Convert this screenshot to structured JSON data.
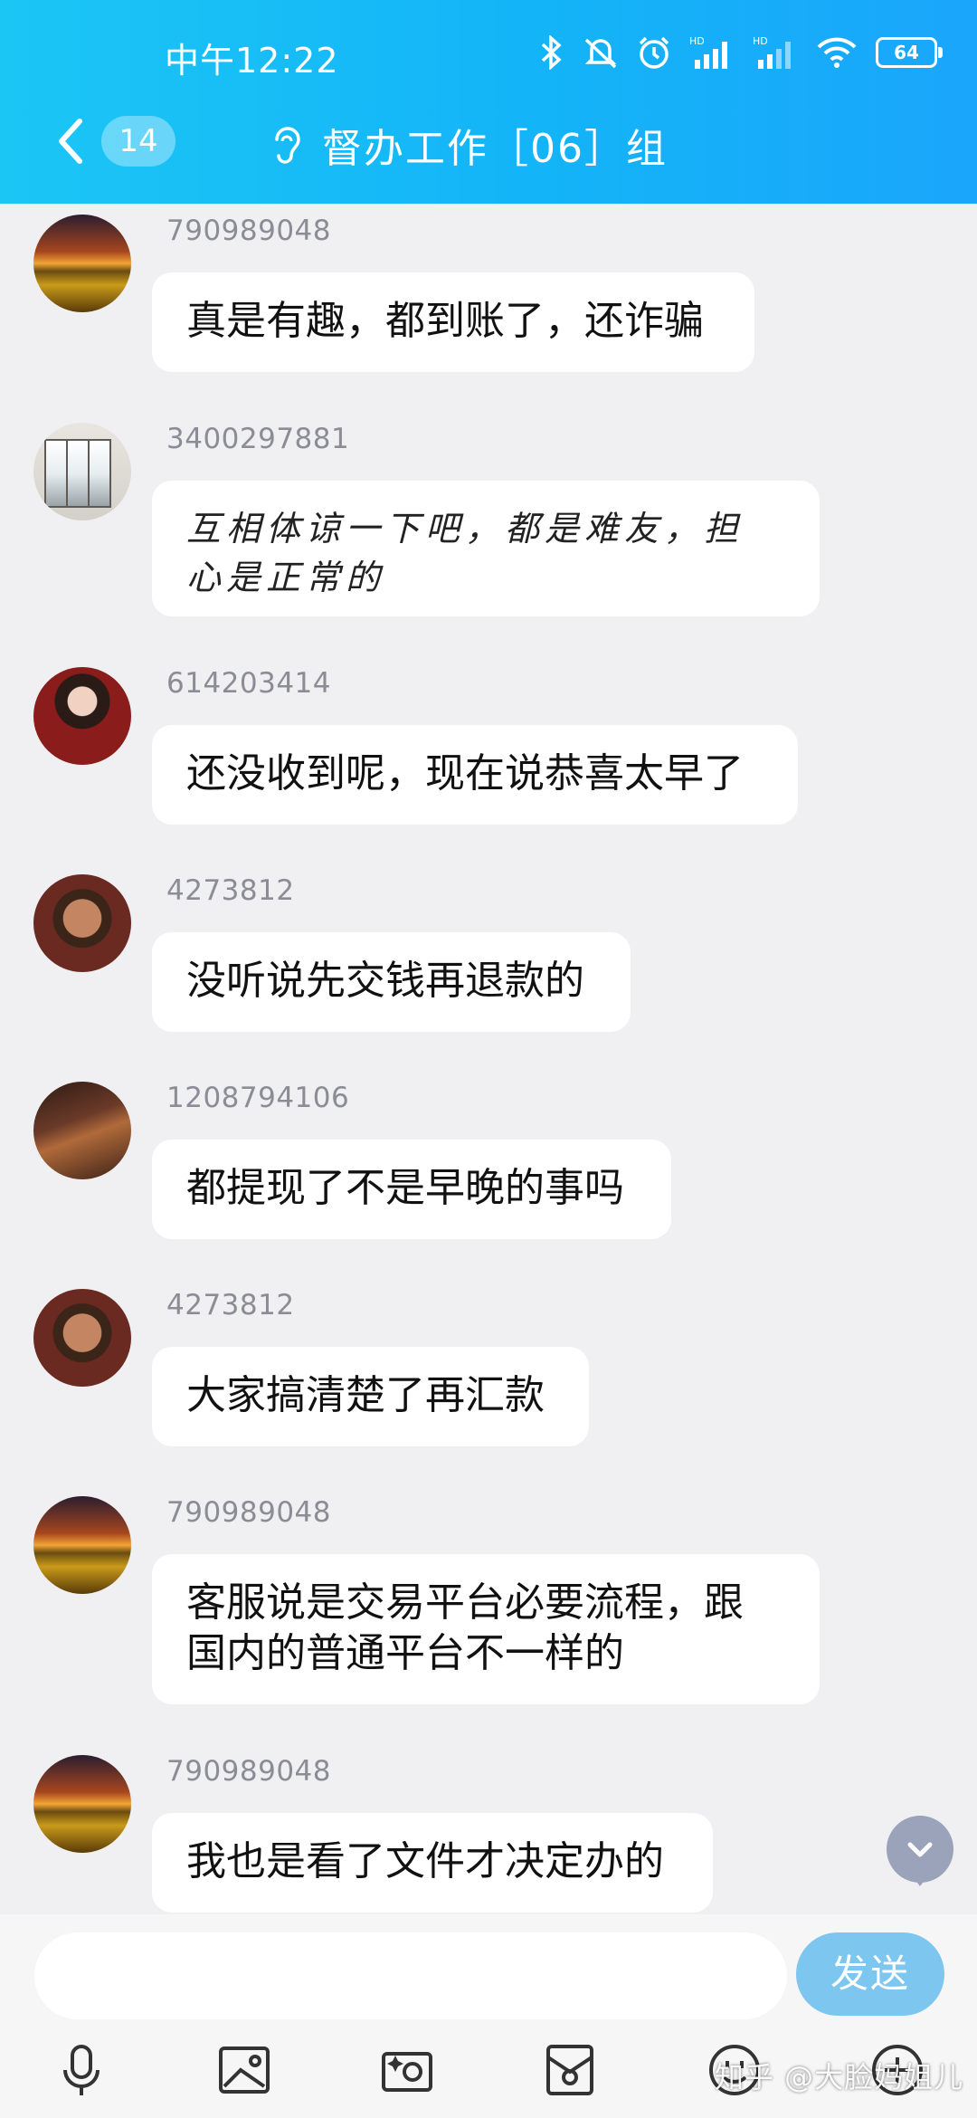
{
  "status_bar": {
    "time": "中午12:22",
    "battery": "64"
  },
  "header": {
    "unread_count": "14",
    "title": "督办工作［06］组"
  },
  "messages": [
    {
      "sender": "790989048",
      "text": "真是有趣，都到账了，还诈骗",
      "avatar": "sunset-avatar"
    },
    {
      "sender": "3400297881",
      "line1": "互相体谅一下吧，都是难友，担",
      "line2": "心是正常的",
      "avatar": "screen-avatar"
    },
    {
      "sender": "614203414",
      "text": "还没收到呢，现在说恭喜太早了",
      "avatar": "woman-avatar"
    },
    {
      "sender": "4273812",
      "text": "没听说先交钱再退款的",
      "avatar": "man-avatar"
    },
    {
      "sender": "1208794106",
      "text": "都提现了不是早晚的事吗",
      "avatar": "room-avatar"
    },
    {
      "sender": "4273812",
      "text": "大家搞清楚了再汇款",
      "avatar": "man-avatar"
    },
    {
      "sender": "790989048",
      "line1": "客服说是交易平台必要流程，跟",
      "line2": "国内的普通平台不一样的",
      "avatar": "sunset-avatar"
    },
    {
      "sender": "790989048",
      "text": "我也是看了文件才决定办的",
      "avatar": "sunset-avatar"
    }
  ],
  "input_bar": {
    "placeholder": "",
    "send_label": "发送"
  },
  "toolbar": [
    "microphone-icon",
    "image-icon",
    "camera-icon",
    "file-icon",
    "emoji-icon",
    "plus-icon"
  ],
  "watermark": "知乎 @大脸妈姐儿",
  "colors": {
    "header": "#14b4f8",
    "send_button": "#7cc6ef",
    "background": "#f0f0f2"
  }
}
